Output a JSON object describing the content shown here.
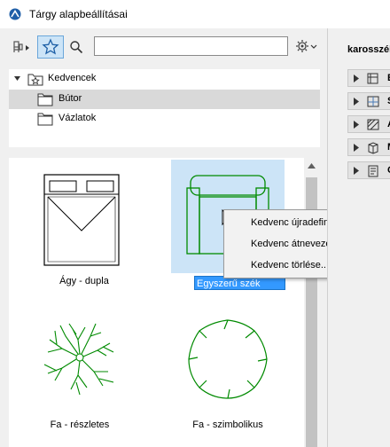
{
  "window": {
    "title": "Tárgy alapbeállításai"
  },
  "toolbar": {
    "search_value": ""
  },
  "tree": {
    "root": "Kedvencek",
    "children": [
      "Bútor",
      "Vázlatok"
    ]
  },
  "gallery": {
    "items": [
      {
        "label": "Ágy - dupla"
      },
      {
        "label": "Egyszerű szék"
      },
      {
        "label": "Fa - részletes"
      },
      {
        "label": "Fa - szimbolikus"
      }
    ]
  },
  "context_menu": {
    "items": [
      "Kedvenc újradefiniálása",
      "Kedvenc átnevezése...",
      "Kedvenc törlése..."
    ]
  },
  "right_panel": {
    "title": "karosszék",
    "rows": [
      {
        "icon": "grid-object-icon",
        "letter": "E"
      },
      {
        "icon": "floor-plan-icon",
        "letter": "S"
      },
      {
        "icon": "hatch-icon",
        "letter": "A"
      },
      {
        "icon": "model-icon",
        "letter": "M"
      },
      {
        "icon": "listing-icon",
        "letter": "C"
      }
    ]
  },
  "colors": {
    "selection": "#cce4f7",
    "edit_highlight": "#3399ff",
    "symbol_green": "#008a00"
  }
}
